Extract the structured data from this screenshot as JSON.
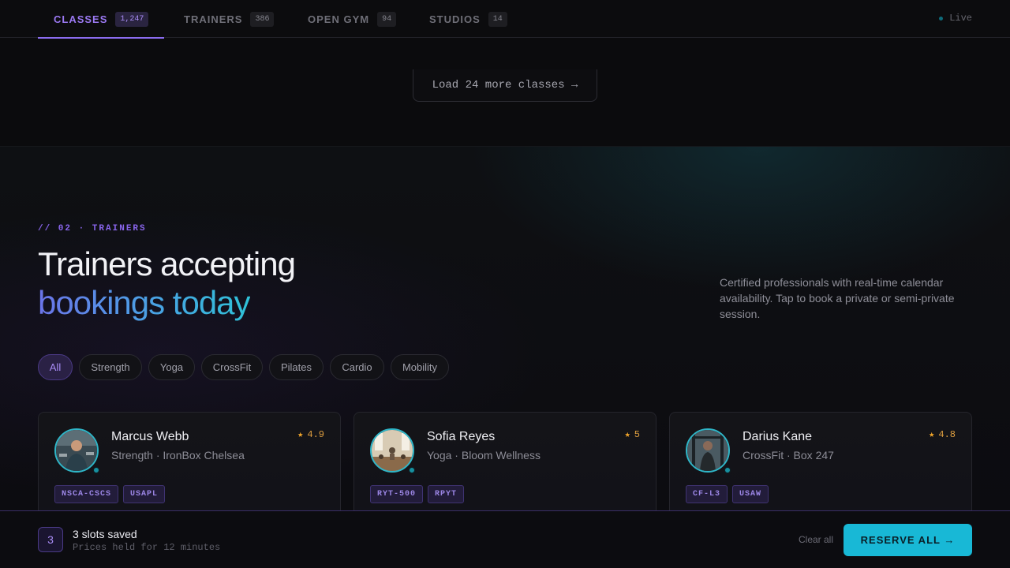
{
  "nav": {
    "tabs": [
      {
        "label": "CLASSES",
        "count": "1,247",
        "active": true
      },
      {
        "label": "TRAINERS",
        "count": "386",
        "active": false
      },
      {
        "label": "OPEN GYM",
        "count": "94",
        "active": false
      },
      {
        "label": "STUDIOS",
        "count": "14",
        "active": false
      }
    ],
    "live_label": "Live"
  },
  "upper": {
    "load_more_label": "Load 24 more classes →"
  },
  "trainers_section": {
    "eyebrow": "// 02 · TRAINERS",
    "title_line1": "Trainers accepting",
    "title_line2": "bookings today",
    "description": "Certified professionals with real-time calendar availability. Tap to book a private or semi-private session.",
    "filters": [
      "All",
      "Strength",
      "Yoga",
      "CrossFit",
      "Pilates",
      "Cardio",
      "Mobility"
    ],
    "active_filter": "All",
    "cards": [
      {
        "name": "Marcus Webb",
        "subtitle": "Strength · IronBox Chelsea",
        "rating": "4.9",
        "badges": [
          "NSCA-CSCS",
          "USAPL"
        ]
      },
      {
        "name": "Sofia Reyes",
        "subtitle": "Yoga · Bloom Wellness",
        "rating": "5",
        "badges": [
          "RYT-500",
          "RPYT"
        ]
      },
      {
        "name": "Darius Kane",
        "subtitle": "CrossFit · Box 247",
        "rating": "4.8",
        "badges": [
          "CF-L3",
          "USAW"
        ]
      }
    ]
  },
  "bottom_bar": {
    "slot_count": "3",
    "title": "3 slots saved",
    "subtitle": "Prices held for 12 minutes",
    "clear_label": "Clear all",
    "reserve_label": "RESERVE ALL →"
  },
  "colors": {
    "accent_purple": "#8b6cf0",
    "accent_cyan": "#18b8d6",
    "star": "#f2a62a",
    "background": "#0b0b0d"
  }
}
